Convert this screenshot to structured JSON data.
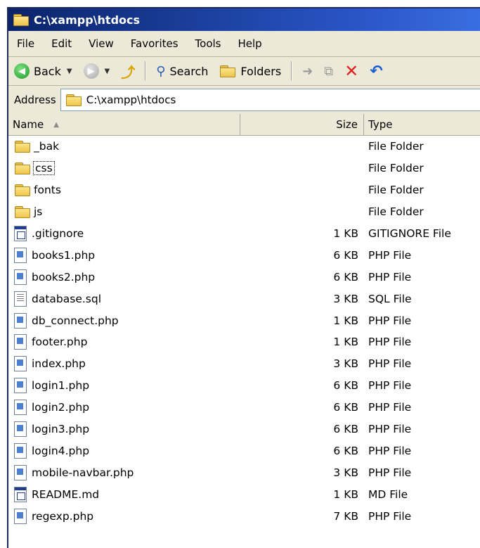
{
  "window": {
    "title": "C:\\xampp\\htdocs"
  },
  "menu": [
    {
      "label": "File"
    },
    {
      "label": "Edit"
    },
    {
      "label": "View"
    },
    {
      "label": "Favorites"
    },
    {
      "label": "Tools"
    },
    {
      "label": "Help"
    }
  ],
  "toolbar": {
    "back_label": "Back",
    "search_label": "Search",
    "folders_label": "Folders"
  },
  "address": {
    "label": "Address",
    "value": "C:\\xampp\\htdocs"
  },
  "columns": {
    "name": "Name",
    "size": "Size",
    "type": "Type"
  },
  "files": [
    {
      "name": "_bak",
      "size": "",
      "type": "File Folder",
      "icon": "folder-icon"
    },
    {
      "name": "css",
      "size": "",
      "type": "File Folder",
      "icon": "folder-icon"
    },
    {
      "name": "fonts",
      "size": "",
      "type": "File Folder",
      "icon": "folder-icon"
    },
    {
      "name": "js",
      "size": "",
      "type": "File Folder",
      "icon": "folder-icon"
    },
    {
      "name": ".gitignore",
      "size": "1 KB",
      "type": "GITIGNORE File",
      "icon": "generic-file-icon"
    },
    {
      "name": "books1.php",
      "size": "6 KB",
      "type": "PHP File",
      "icon": "php-file-icon"
    },
    {
      "name": "books2.php",
      "size": "6 KB",
      "type": "PHP File",
      "icon": "php-file-icon"
    },
    {
      "name": "database.sql",
      "size": "3 KB",
      "type": "SQL File",
      "icon": "text-file-icon"
    },
    {
      "name": "db_connect.php",
      "size": "1 KB",
      "type": "PHP File",
      "icon": "php-file-icon"
    },
    {
      "name": "footer.php",
      "size": "1 KB",
      "type": "PHP File",
      "icon": "php-file-icon"
    },
    {
      "name": "index.php",
      "size": "3 KB",
      "type": "PHP File",
      "icon": "php-file-icon"
    },
    {
      "name": "login1.php",
      "size": "6 KB",
      "type": "PHP File",
      "icon": "php-file-icon"
    },
    {
      "name": "login2.php",
      "size": "6 KB",
      "type": "PHP File",
      "icon": "php-file-icon"
    },
    {
      "name": "login3.php",
      "size": "6 KB",
      "type": "PHP File",
      "icon": "php-file-icon"
    },
    {
      "name": "login4.php",
      "size": "6 KB",
      "type": "PHP File",
      "icon": "php-file-icon"
    },
    {
      "name": "mobile-navbar.php",
      "size": "3 KB",
      "type": "PHP File",
      "icon": "php-file-icon"
    },
    {
      "name": "README.md",
      "size": "1 KB",
      "type": "MD File",
      "icon": "generic-file-icon"
    },
    {
      "name": "regexp.php",
      "size": "7 KB",
      "type": "PHP File",
      "icon": "php-file-icon"
    }
  ],
  "focused_index": 1
}
